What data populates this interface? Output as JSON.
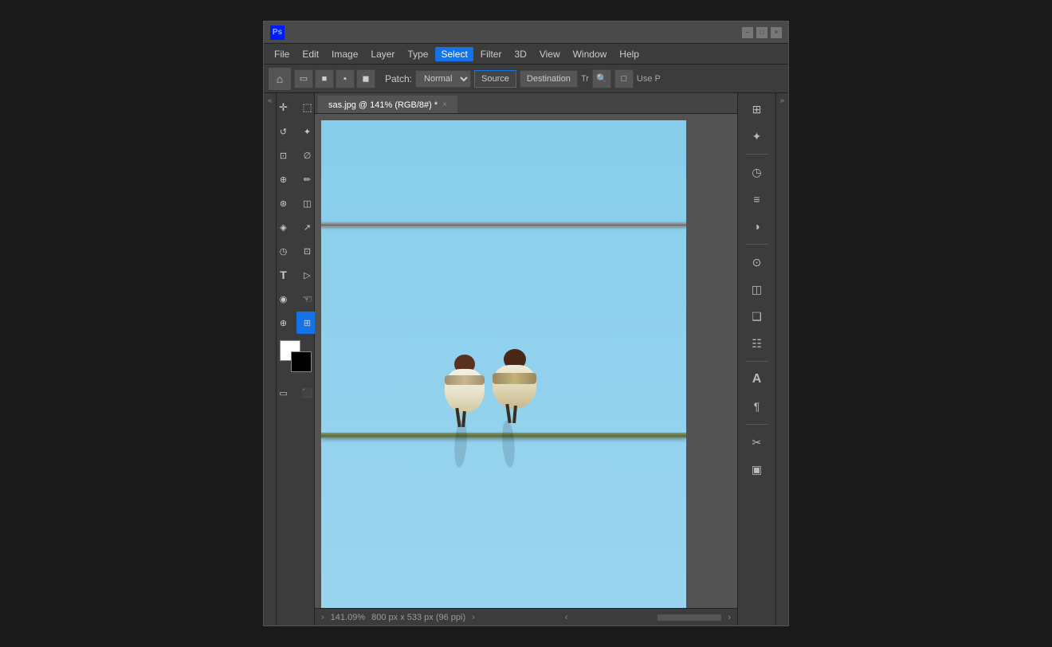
{
  "window": {
    "title": "Adobe Photoshop",
    "logo": "Ps"
  },
  "titlebar": {
    "minimize_label": "–",
    "maximize_label": "□",
    "close_label": "×"
  },
  "menu": {
    "items": [
      "File",
      "Edit",
      "Image",
      "Layer",
      "Type",
      "Select",
      "Filter",
      "3D",
      "View",
      "Window",
      "Help"
    ]
  },
  "toolbar": {
    "home_icon": "⌂",
    "patch_label": "Patch:",
    "mode_options": [
      "Normal"
    ],
    "mode_selected": "Normal",
    "source_label": "Source",
    "destination_label": "Destination",
    "transform_label": "Tr",
    "use_label": "Use P"
  },
  "tab": {
    "title": "sas.jpg @ 141% (RGB/8#) *",
    "close": "×"
  },
  "canvas": {
    "zoom": "141.09%",
    "dimensions": "800 px x 533 px (96 ppi)"
  },
  "tools": {
    "items": [
      {
        "name": "move-tool",
        "icon": "✛"
      },
      {
        "name": "marquee-tool",
        "icon": "⬜"
      },
      {
        "name": "lasso-tool",
        "icon": "⌇"
      },
      {
        "name": "magic-wand-tool",
        "icon": "✦"
      },
      {
        "name": "crop-tool",
        "icon": "⌹"
      },
      {
        "name": "eyedropper-tool",
        "icon": "⊘"
      },
      {
        "name": "healing-tool",
        "icon": "⊕"
      },
      {
        "name": "brush-tool",
        "icon": "∫"
      },
      {
        "name": "clone-tool",
        "icon": "⊛"
      },
      {
        "name": "eraser-tool",
        "icon": "◫"
      },
      {
        "name": "paint-bucket-tool",
        "icon": "◈"
      },
      {
        "name": "dodge-tool",
        "icon": "◷"
      },
      {
        "name": "pen-tool",
        "icon": "◻"
      },
      {
        "name": "type-tool",
        "icon": "T"
      },
      {
        "name": "path-tool",
        "icon": "◁"
      },
      {
        "name": "hand-tool",
        "icon": "☜"
      },
      {
        "name": "zoom-tool",
        "icon": "⊕"
      },
      {
        "name": "marquee-select-tool",
        "icon": "⊞"
      }
    ],
    "fg_color": "#ffffff",
    "bg_color": "#000000"
  },
  "right_panel": {
    "sections": [
      {
        "name": "libraries-icon",
        "icon": "⊞"
      },
      {
        "name": "ai-icon",
        "icon": "✦"
      },
      {
        "name": "history-icon",
        "icon": "◷"
      },
      {
        "name": "layers-icon",
        "icon": "≡"
      },
      {
        "name": "channels-icon",
        "icon": "◑"
      },
      {
        "name": "properties-icon",
        "icon": "⊙"
      },
      {
        "name": "adjustments-icon",
        "icon": "◫"
      },
      {
        "name": "type-icon",
        "icon": "A"
      },
      {
        "name": "paragraph-icon",
        "icon": "¶"
      },
      {
        "name": "tools-icon",
        "icon": "✂"
      },
      {
        "name": "info-icon",
        "icon": "▣"
      },
      {
        "name": "layer-comp-icon",
        "icon": "❑"
      }
    ]
  }
}
